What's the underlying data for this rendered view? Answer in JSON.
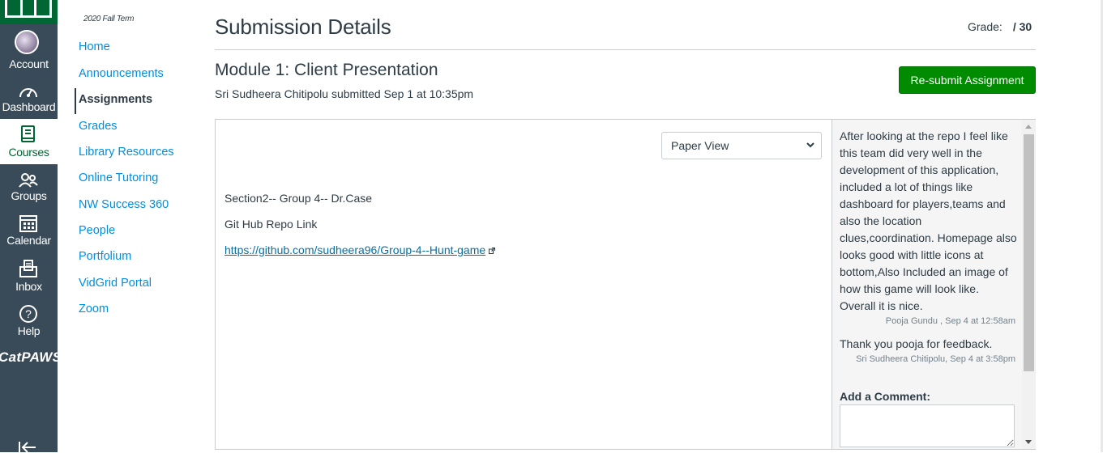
{
  "global_nav": {
    "account": "Account",
    "dashboard": "Dashboard",
    "courses": "Courses",
    "groups": "Groups",
    "calendar": "Calendar",
    "inbox": "Inbox",
    "help": "Help",
    "brand": "CatPAWS"
  },
  "course_nav": {
    "term": "2020 Fall Term",
    "items": [
      "Home",
      "Announcements",
      "Assignments",
      "Grades",
      "Library Resources",
      "Online Tutoring",
      "NW Success 360",
      "People",
      "Portfolium",
      "VidGrid Portal",
      "Zoom"
    ],
    "active": "Assignments"
  },
  "header": {
    "title": "Submission Details",
    "grade_label": "Grade:",
    "grade_value": "/ 30"
  },
  "assignment": {
    "title": "Module 1: Client Presentation",
    "submitted": "Sri Sudheera Chitipolu submitted Sep 1 at 10:35pm",
    "resubmit_label": "Re-submit Assignment"
  },
  "submission": {
    "view": "Paper View",
    "line1": "Section2-- Group 4-- Dr.Case",
    "line2": "Git Hub Repo Link",
    "link": "https://github.com/sudheera96/Group-4--Hunt-game"
  },
  "comments": [
    {
      "text": "After looking at the repo I feel like this team did very well in the development of this application, included a lot of things like dashboard for players,teams and also the location clues,coordination. Homepage also looks good with little icons at bottom,Also  Included an image of how this game will look like. Overall it is nice.",
      "meta": "Pooja Gundu , Sep 4 at 12:58am"
    },
    {
      "text": "Thank you pooja for feedback.",
      "meta": "Sri Sudheera Chitipolu, Sep 4 at 3:58pm"
    }
  ],
  "add_comment_label": "Add a Comment:",
  "colors": {
    "nav_bg": "#394b58",
    "brand_green": "#006633",
    "link_blue": "#008ee2",
    "button_green": "#008b00"
  }
}
